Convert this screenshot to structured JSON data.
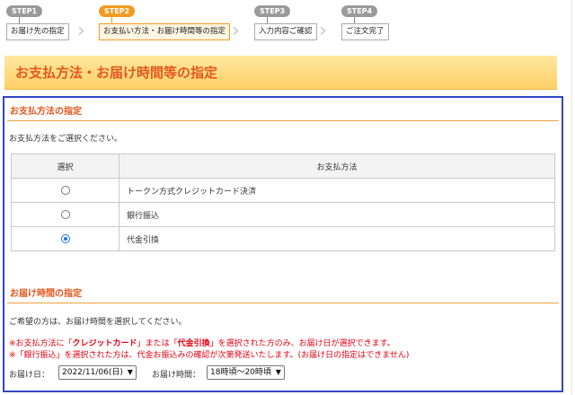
{
  "steps": [
    {
      "badge": "STEP1",
      "label": "お届け先の指定"
    },
    {
      "badge": "STEP2",
      "label": "お支払い方法・お届け時間等の指定"
    },
    {
      "badge": "STEP3",
      "label": "入力内容ご確認"
    },
    {
      "badge": "STEP4",
      "label": "ご注文完了"
    }
  ],
  "banner": {
    "title": "お支払方法・お届け時間等の指定"
  },
  "payment": {
    "section_title": "お支払方法の指定",
    "instruction": "お支払方法をご選択ください。",
    "table_headers": {
      "select": "選択",
      "method": "お支払方法"
    },
    "methods": [
      {
        "label": "トークン方式クレジットカード決済",
        "selected": false
      },
      {
        "label": "銀行振込",
        "selected": false
      },
      {
        "label": "代金引換",
        "selected": true
      }
    ]
  },
  "delivery": {
    "section_title": "お届け時間の指定",
    "instruction": "ご希望の方は、お届け時間を選択してください。",
    "note1_pre": "※お支払方法に「",
    "note1_credit": "クレジットカード",
    "note1_mid": "」または「",
    "note1_cod": "代金引換",
    "note1_post": "」を選択された方のみ、お届け日が選択できます。",
    "note2": "※「銀行振込」を選択された方は、代金お振込みの確認が次第発送いたします。(お届け日の指定はできません)",
    "date_label": "お届け日：",
    "date_value": "2022/11/06(日)",
    "time_label": "お届け時間：",
    "time_value": "18時頃～20時頃"
  },
  "colors": {
    "accent": "#e4571e",
    "step_active": "#f39a20",
    "panel_border": "#3344cc",
    "warning": "#e60012"
  },
  "icons": {
    "chevron": "chevron-right-icon",
    "dropdown": "chevron-down-icon"
  }
}
